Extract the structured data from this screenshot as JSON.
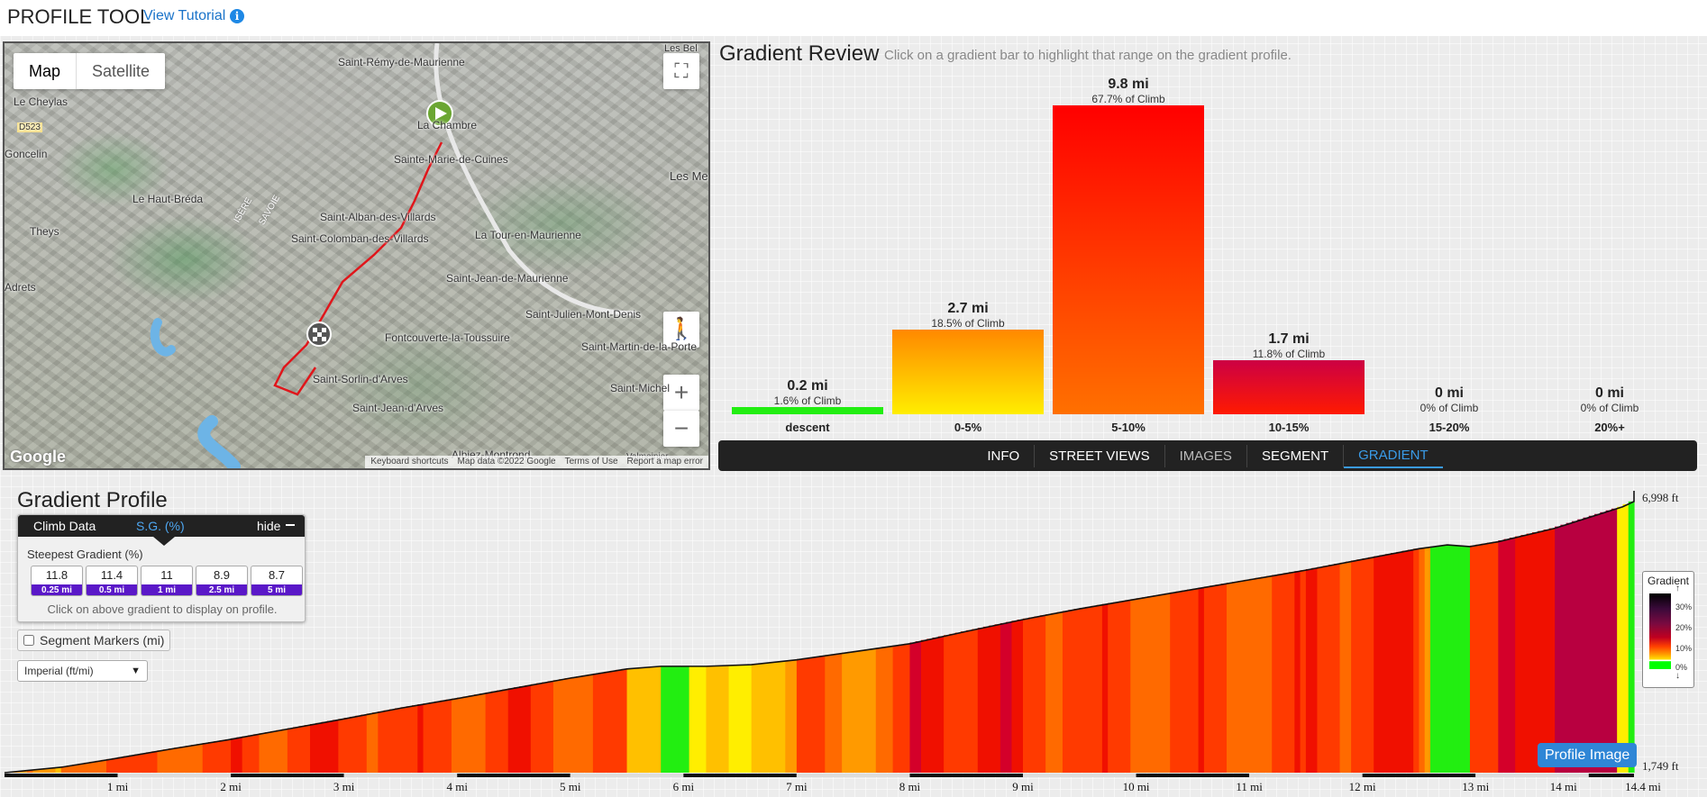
{
  "header": {
    "title": "PROFILE TOOL",
    "tutorial_link": "View Tutorial",
    "info_glyph": "i"
  },
  "map": {
    "type_buttons": [
      "Map",
      "Satellite"
    ],
    "labels": [
      "Saint-Rémy-de-Maurienne",
      "Le Cheylas",
      "D523",
      "Goncelin",
      "Le Haut-Bréda",
      "La Chambre",
      "Sainte-Marie-de-Cuines",
      "Saint-Alban-des-Villards",
      "Saint-Colomban-des-Villards",
      "Theys",
      "La Tour-en-Maurienne",
      "Saint-Jean-de-Maurienne",
      "Saint-Julien-Mont-Denis",
      "Fontcouverte-la-Toussuire",
      "Saint-Martin-de-la-Porte",
      "Saint-Sorlin-d'Arves",
      "Saint-Jean-d'Arves",
      "Saint-Michel",
      "Albiez-Montrond",
      "Les Me",
      "Les Bel",
      "ISÈRE",
      "SAVOIE",
      "Adrets",
      "Valmeinier"
    ],
    "footer": [
      "Keyboard shortcuts",
      "Map data ©2022 Google",
      "Terms of Use",
      "Report a map error"
    ],
    "logo": "Google",
    "icons": {
      "fullscreen": "fullscreen-icon",
      "pegman": "pegman-icon",
      "zoom_in": "+",
      "zoom_out": "−",
      "start": "start-marker-icon",
      "finish": "finish-flag-icon"
    }
  },
  "gradient_review": {
    "title": "Gradient Review",
    "subtitle": "Click on a gradient bar to highlight that range on the gradient profile.",
    "bars": [
      {
        "category": "descent",
        "distance": "0.2 mi",
        "percent": "1.6% of Climb",
        "share": 1.6,
        "color": "#22ee11"
      },
      {
        "category": "0-5%",
        "distance": "2.7 mi",
        "percent": "18.5% of Climb",
        "share": 18.5,
        "color_top": "#ff8800",
        "color_bottom": "#ffee00"
      },
      {
        "category": "5-10%",
        "distance": "9.8 mi",
        "percent": "67.7% of Climb",
        "share": 67.7,
        "color_top": "#ff0000",
        "color_bottom": "#ff7000"
      },
      {
        "category": "10-15%",
        "distance": "1.7 mi",
        "percent": "11.8% of Climb",
        "share": 11.8,
        "color_top": "#cc0044",
        "color_bottom": "#ff1a00"
      },
      {
        "category": "15-20%",
        "distance": "0 mi",
        "percent": "0% of Climb",
        "share": 0
      },
      {
        "category": "20%+",
        "distance": "0 mi",
        "percent": "0% of Climb",
        "share": 0
      }
    ],
    "tabs": [
      {
        "label": "INFO",
        "state": "normal"
      },
      {
        "label": "STREET VIEWS",
        "state": "normal"
      },
      {
        "label": "IMAGES",
        "state": "dim"
      },
      {
        "label": "SEGMENT",
        "state": "normal"
      },
      {
        "label": "GRADIENT",
        "state": "active"
      }
    ]
  },
  "gradient_profile": {
    "title": "Gradient Profile",
    "climb_panel": {
      "tab_climb_data": "Climb Data",
      "tab_sg": "S.G. (%)",
      "hide_label": "hide",
      "steepest_label": "Steepest Gradient (%)",
      "steepest": [
        {
          "value": "11.8",
          "distance": "0.25 mi"
        },
        {
          "value": "11.4",
          "distance": "0.5 mi"
        },
        {
          "value": "11",
          "distance": "1 mi"
        },
        {
          "value": "8.9",
          "distance": "2.5 mi"
        },
        {
          "value": "8.7",
          "distance": "5 mi"
        }
      ],
      "hint": "Click on above gradient to display on profile."
    },
    "segment_markers_label": "Segment Markers (mi)",
    "units_selected": "Imperial (ft/mi)",
    "elevation_top": "6,998 ft",
    "elevation_bottom": "1,749 ft",
    "axis_ticks": [
      "1 mi",
      "2 mi",
      "3 mi",
      "4 mi",
      "5 mi",
      "6 mi",
      "7 mi",
      "8 mi",
      "9 mi",
      "10 mi",
      "11 mi",
      "12 mi",
      "13 mi",
      "14 mi",
      "14.4 mi"
    ],
    "legend": {
      "title": "Gradient",
      "ticks": [
        "30%",
        "20%",
        "10%",
        "0%"
      ]
    },
    "profile_image_button": "Profile Image",
    "total_distance_mi": 14.4,
    "elevation_ft_min": 1749,
    "elevation_ft_max": 6998
  }
}
